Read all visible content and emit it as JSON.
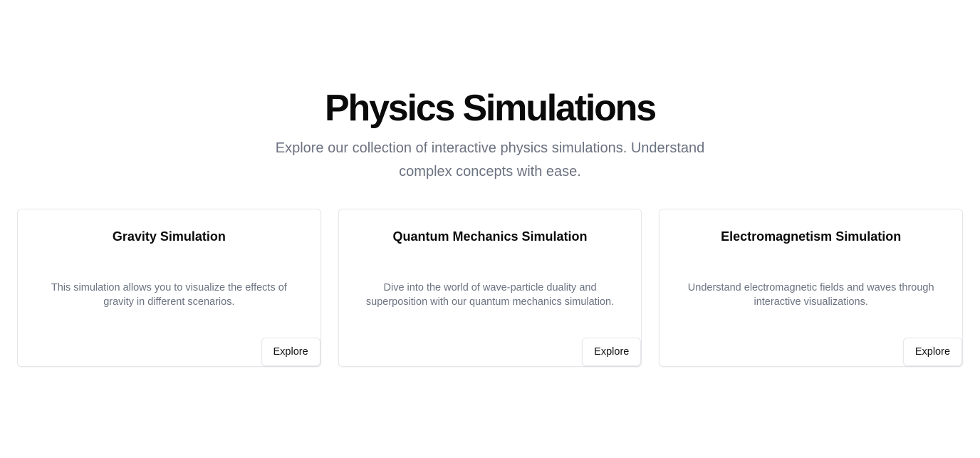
{
  "hero": {
    "title": "Physics Simulations",
    "subtitle": "Explore our collection of interactive physics simulations. Understand complex concepts with ease."
  },
  "cards": [
    {
      "title": "Gravity Simulation",
      "description": "This simulation allows you to visualize the effects of gravity in different scenarios.",
      "button_label": "Explore"
    },
    {
      "title": "Quantum Mechanics Simulation",
      "description": "Dive into the world of wave-particle duality and superposition with our quantum mechanics simulation.",
      "button_label": "Explore"
    },
    {
      "title": "Electromagnetism Simulation",
      "description": "Understand electromagnetic fields and waves through interactive visualizations.",
      "button_label": "Explore"
    }
  ],
  "colors": {
    "heading": "#0a0a0a",
    "muted_text": "#6b7280",
    "border": "#e5e7eb",
    "background": "#ffffff"
  }
}
